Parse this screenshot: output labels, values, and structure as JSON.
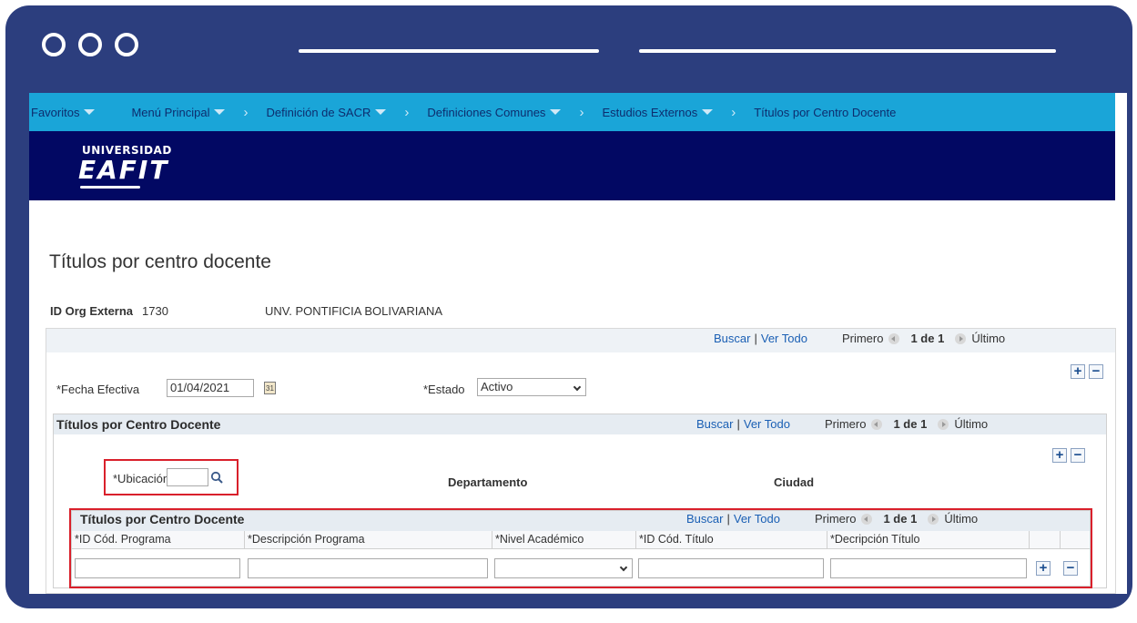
{
  "nav": {
    "items": [
      {
        "label": "Favoritos",
        "caret": true
      },
      {
        "label": "Menú Principal",
        "caret": true
      },
      {
        "label": "Definición de SACR",
        "caret": true
      },
      {
        "label": "Definiciones Comunes",
        "caret": true
      },
      {
        "label": "Estudios Externos",
        "caret": true
      },
      {
        "label": "Títulos por Centro Docente",
        "caret": false
      }
    ]
  },
  "brand": {
    "line1": "UNIVERSIDAD",
    "line2": "EAFIT"
  },
  "page": {
    "title": "Títulos por centro docente",
    "org_label": "ID Org Externa",
    "org_id": "1730",
    "org_name": "UNV. PONTIFICIA BOLIVARIANA"
  },
  "pager": {
    "find": "Buscar",
    "sep": "|",
    "view_all": "Ver Todo",
    "first": "Primero",
    "count": "1 de 1",
    "last": "Último"
  },
  "effdt": {
    "label": "*Fecha Efectiva",
    "value": "01/04/2021",
    "status_label": "*Estado",
    "status_value": "Activo"
  },
  "section1": {
    "title": "Títulos por Centro Docente",
    "location_label": "*Ubicación",
    "location_value": "",
    "department_label": "Departamento",
    "city_label": "Ciudad"
  },
  "section2": {
    "title": "Títulos por Centro Docente",
    "columns": [
      "*ID Cód. Programa",
      "*Descripción Programa",
      "*Nivel Académico",
      "*ID Cód. Título",
      "*Decripción Título"
    ]
  },
  "colors": {
    "nav": "#1aa5d8",
    "brand": "#020863",
    "frame": "#2c3e7e",
    "highlight": "#d9202b"
  }
}
